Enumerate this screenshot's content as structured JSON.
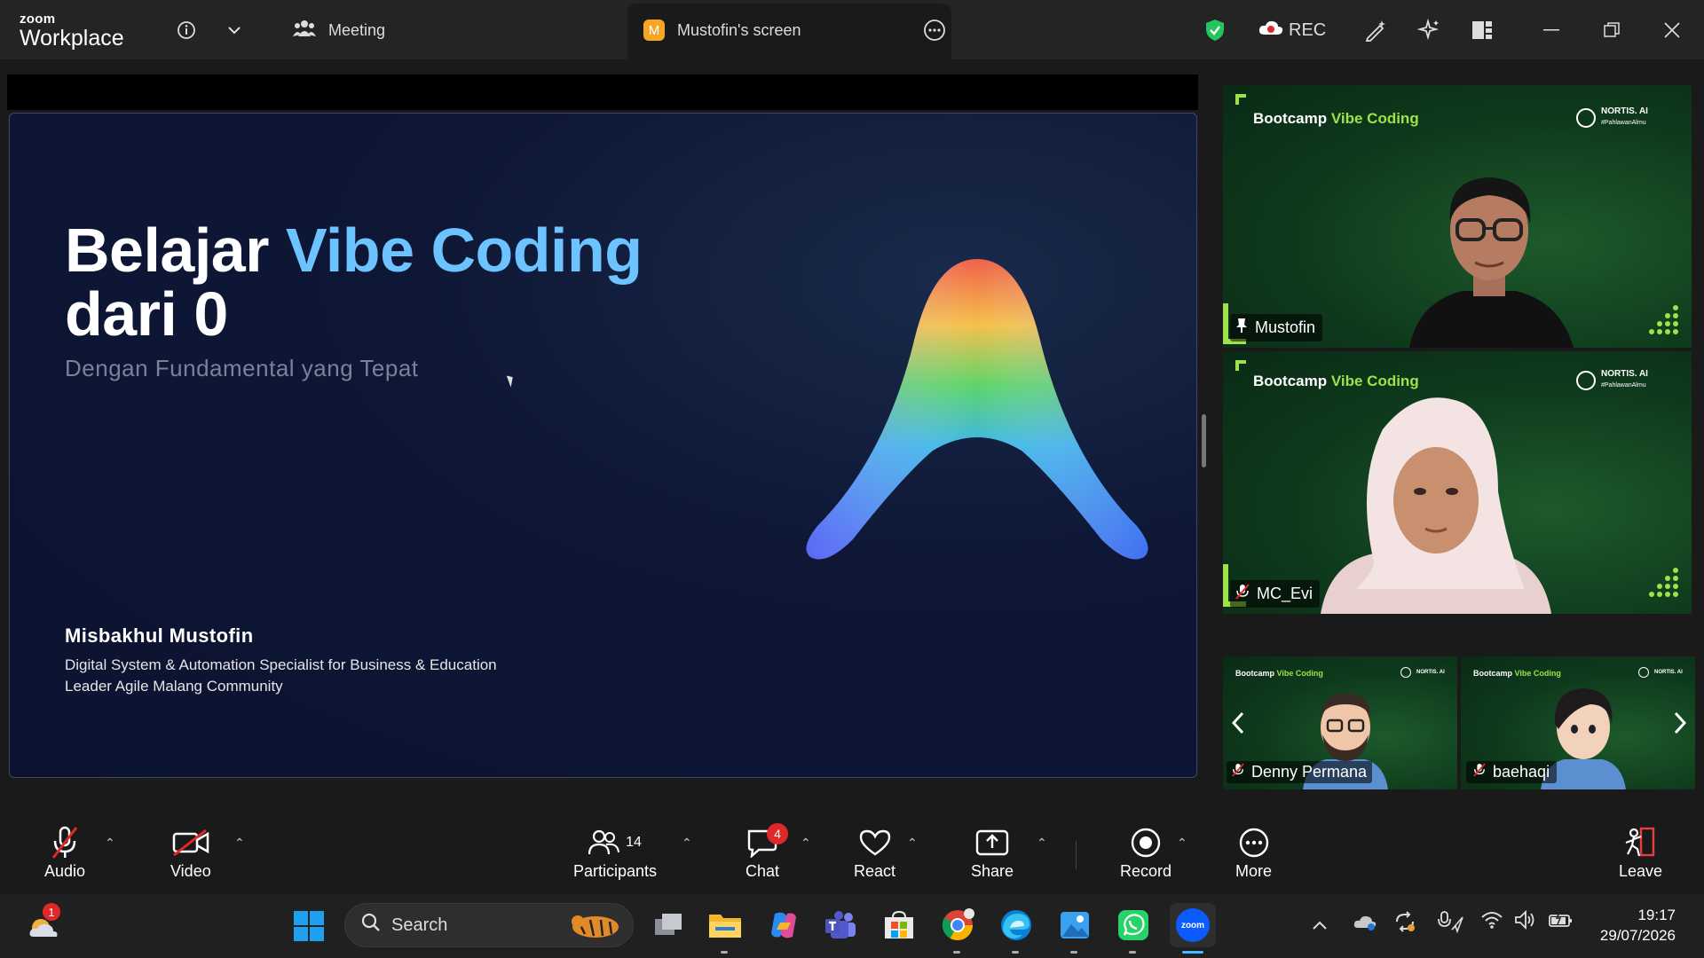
{
  "titlebar": {
    "brand_top": "zoom",
    "brand_bottom": "Workplace",
    "meeting_tab": "Meeting",
    "screen_tab": "Mustofin's screen",
    "screen_tab_initial": "M",
    "rec_label": "REC"
  },
  "slide": {
    "title_part1": "Belajar ",
    "title_accent": "Vibe Coding",
    "title_line2": "dari 0",
    "subtitle": "Dengan Fundamental yang Tepat",
    "speaker_name": "Misbakhul  Mustofin",
    "speaker_role1": "Digital System & Automation Specialist for Business & Education",
    "speaker_role2": "Leader Agile Malang Community"
  },
  "panels": {
    "bootcamp_prefix": "Bootcamp ",
    "bootcamp_accent": "Vibe Coding",
    "nortis_label": "NORTIS. AI",
    "nortis_sub": "#PahlawanAlmu",
    "participants": [
      {
        "name": "Mustofin"
      },
      {
        "name": "MC_Evi"
      },
      {
        "name": "Denny Permana"
      },
      {
        "name": "baehaqi"
      }
    ]
  },
  "toolbar": {
    "audio": "Audio",
    "video": "Video",
    "participants": "Participants",
    "participants_count": "14",
    "chat": "Chat",
    "chat_badge": "4",
    "react": "React",
    "share": "Share",
    "record": "Record",
    "more": "More",
    "leave": "Leave"
  },
  "taskbar": {
    "search_placeholder": "Search",
    "weather_badge": "1",
    "time": "19:17",
    "date": "29/07/2026",
    "zoom_app_label": "zoom"
  },
  "colors": {
    "accent_blue": "#6cc3ff",
    "active_speaker": "#26d07c",
    "panel_green": "#0f3a1f",
    "brand_lime": "#9fe24a",
    "muted_red": "#e02828"
  }
}
